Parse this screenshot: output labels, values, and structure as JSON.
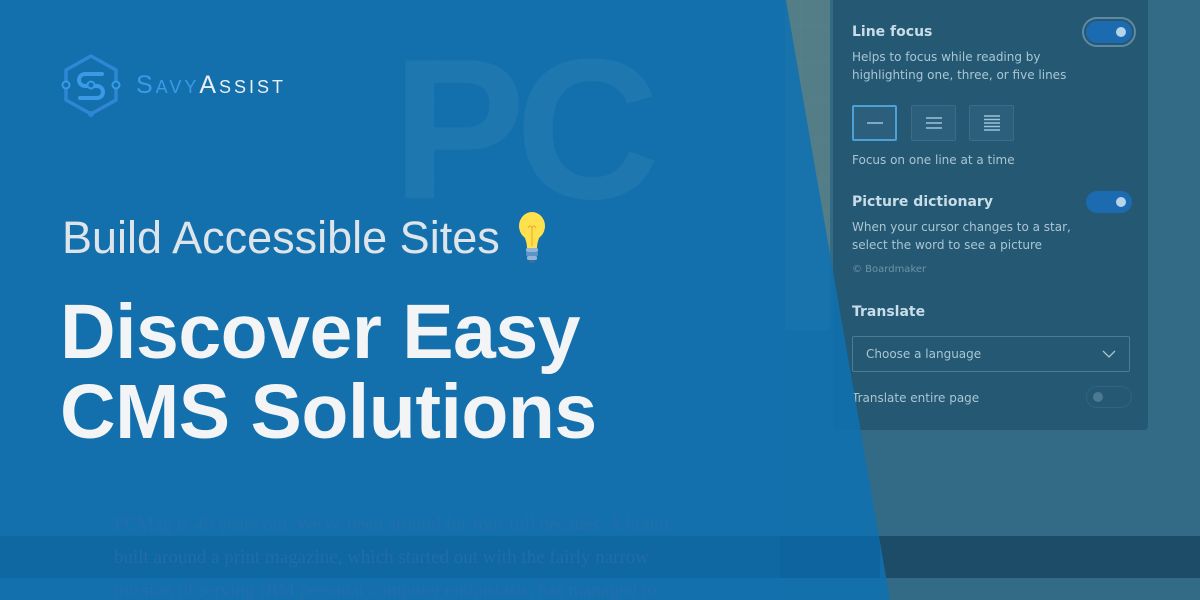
{
  "brand": {
    "name_part1": "Savy",
    "name_part2": "Assist",
    "logo_icon": "circuit-s-hexagon-icon",
    "accent": "#3a9ae8"
  },
  "hero": {
    "subtitle": "Build Accessible Sites",
    "subtitle_icon": "lightbulb-icon",
    "headline_line1": "Discover Easy",
    "headline_line2": "CMS Solutions",
    "overlay_color": "#1071b0"
  },
  "background": {
    "masthead_text": "PC",
    "article_lines": [
      "PCMag is 40 years old. We've been around for four full decades. A brand",
      "built around a print magazine, which started out with the fairly narrow",
      "mission of serving IBM personal computer enthusiasts, has managed to"
    ]
  },
  "panel": {
    "line_focus": {
      "title": "Line focus",
      "enabled": true,
      "description_line1": "Helps to focus while reading by",
      "description_line2": "highlighting one, three, or five lines",
      "options": [
        {
          "label": "one line",
          "icon": "one-line-icon",
          "selected": true
        },
        {
          "label": "three lines",
          "icon": "three-lines-icon",
          "selected": false
        },
        {
          "label": "five lines",
          "icon": "five-lines-icon",
          "selected": false
        }
      ],
      "caption": "Focus on one line at a time"
    },
    "picture_dictionary": {
      "title": "Picture dictionary",
      "enabled": true,
      "description_line1": "When your cursor changes to a star,",
      "description_line2": "select the word to see a picture",
      "credit": "© Boardmaker"
    },
    "translate": {
      "title": "Translate",
      "select_value": "Choose a language",
      "entire_page_label": "Translate entire page",
      "entire_page_enabled": false
    }
  }
}
